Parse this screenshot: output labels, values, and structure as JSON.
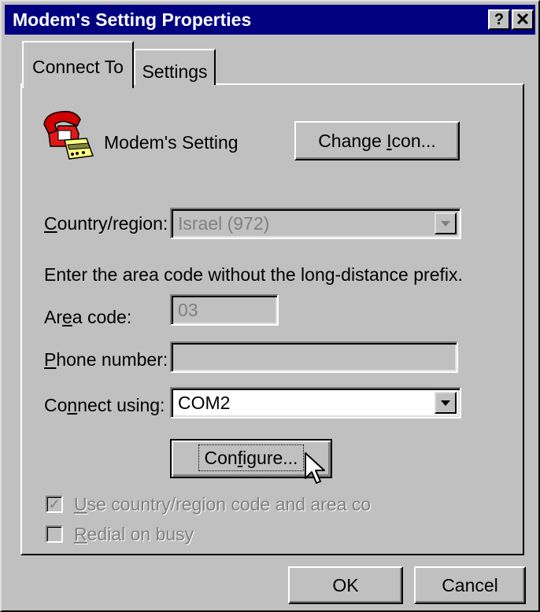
{
  "window": {
    "title": "Modem's Setting Properties",
    "help_glyph": "?",
    "close_glyph": "✕"
  },
  "tabs": [
    {
      "label": "Connect To",
      "active": true
    },
    {
      "label": "Settings",
      "active": false
    }
  ],
  "connection": {
    "name": "Modem's Setting",
    "change_icon_button": {
      "before": "Change ",
      "mnemonic": "I",
      "after": "con..."
    }
  },
  "country": {
    "label_mnemonic": "C",
    "label_rest": "ountry/region:",
    "value": "Israel (972)"
  },
  "instruction": "Enter the area code without the long-distance prefix.",
  "area_code": {
    "label_before": "Ar",
    "label_mnemonic": "e",
    "label_after": "a code:",
    "value": "03"
  },
  "phone_number": {
    "label_mnemonic": "P",
    "label_rest": "hone number:",
    "value": ""
  },
  "connect_using": {
    "label_before": "Co",
    "label_mnemonic": "n",
    "label_after": "nect using:",
    "value": "COM2"
  },
  "configure_button": {
    "before": "Con",
    "mnemonic": "f",
    "after": "igure..."
  },
  "options": {
    "use_country_code": {
      "checked": true,
      "label_mnemonic": "U",
      "label_rest": "se country/region code and area co"
    },
    "redial_on_busy": {
      "checked": false,
      "label_mnemonic": "R",
      "label_rest": "edial on busy"
    }
  },
  "buttons": {
    "ok": "OK",
    "cancel": "Cancel"
  }
}
